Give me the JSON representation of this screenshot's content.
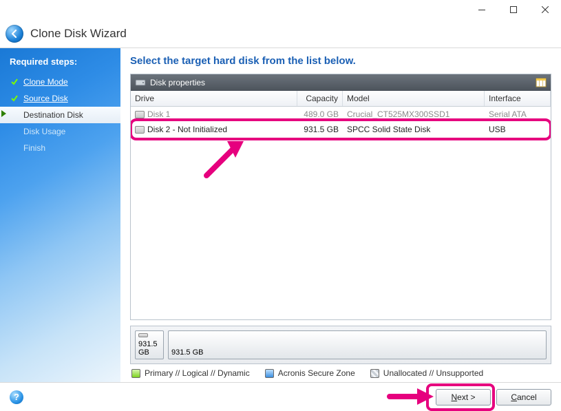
{
  "window": {
    "title": "Clone Disk Wizard"
  },
  "sidebar": {
    "heading": "Required steps:",
    "items": [
      {
        "label": "Clone Mode",
        "state": "done"
      },
      {
        "label": "Source Disk",
        "state": "done"
      },
      {
        "label": "Destination Disk",
        "state": "active"
      },
      {
        "label": "Disk Usage",
        "state": "future"
      },
      {
        "label": "Finish",
        "state": "future"
      }
    ]
  },
  "content": {
    "title": "Select the target hard disk from the list below.",
    "panel_heading": "Disk properties",
    "columns": {
      "drive": "Drive",
      "capacity": "Capacity",
      "model": "Model",
      "interface": "Interface"
    },
    "rows": [
      {
        "drive": "Disk 1",
        "capacity": "489.0 GB",
        "model": "Crucial_CT525MX300SSD1",
        "interface": "Serial ATA",
        "dim": true
      },
      {
        "drive": "Disk 2 - Not Initialized",
        "capacity": "931.5 GB",
        "model": "SPCC Solid State Disk",
        "interface": "USB",
        "highlight": true
      }
    ],
    "diskmap": {
      "small_label": "931.5 GB",
      "big_label": "931.5 GB"
    },
    "legend": {
      "primary": "Primary // Logical // Dynamic",
      "zone": "Acronis Secure Zone",
      "unalloc": "Unallocated // Unsupported"
    }
  },
  "footer": {
    "next_prefix": "N",
    "next_rest": "ext >",
    "cancel_prefix": "C",
    "cancel_rest": "ancel"
  }
}
